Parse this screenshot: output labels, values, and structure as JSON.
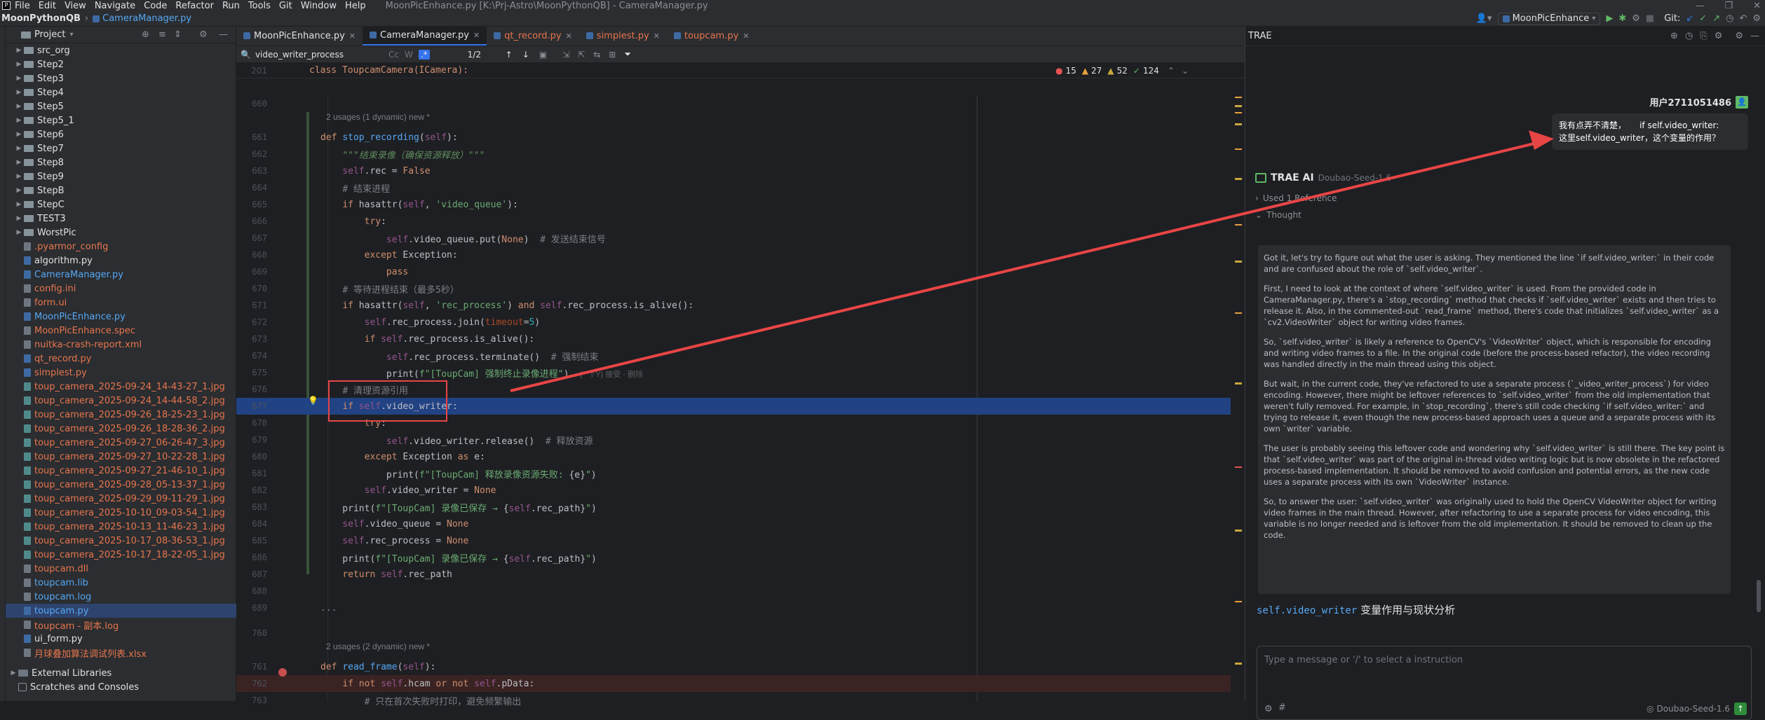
{
  "titlebar": {
    "menu": [
      "File",
      "Edit",
      "View",
      "Navigate",
      "Code",
      "Refactor",
      "Run",
      "Tools",
      "Git",
      "Window",
      "Help"
    ],
    "window_title": "MoonPicEnhance.py [K:\\Prj-Astro\\MoonPythonQB] - CameraManager.py"
  },
  "navbar": {
    "project": "MoonPythonQB",
    "file": "CameraManager.py",
    "run_config": "MoonPicEnhance",
    "git_label": "Git:"
  },
  "project_panel": {
    "title": "Project",
    "items": [
      {
        "label": "src_org",
        "type": "folder",
        "color": "#dfe1e5"
      },
      {
        "label": "Step2",
        "type": "folder",
        "color": "#dfe1e5"
      },
      {
        "label": "Step3",
        "type": "folder",
        "color": "#dfe1e5"
      },
      {
        "label": "Step4",
        "type": "folder",
        "color": "#dfe1e5"
      },
      {
        "label": "Step5",
        "type": "folder",
        "color": "#dfe1e5"
      },
      {
        "label": "Step5_1",
        "type": "folder",
        "color": "#dfe1e5"
      },
      {
        "label": "Step6",
        "type": "folder",
        "color": "#dfe1e5"
      },
      {
        "label": "Step7",
        "type": "folder",
        "color": "#dfe1e5"
      },
      {
        "label": "Step8",
        "type": "folder",
        "color": "#dfe1e5"
      },
      {
        "label": "Step9",
        "type": "folder",
        "color": "#dfe1e5"
      },
      {
        "label": "StepB",
        "type": "folder",
        "color": "#dfe1e5"
      },
      {
        "label": "StepC",
        "type": "folder",
        "color": "#dfe1e5"
      },
      {
        "label": "TEST3",
        "type": "folder",
        "color": "#dfe1e5"
      },
      {
        "label": "WorstPic",
        "type": "folder",
        "color": "#dfe1e5"
      },
      {
        "label": ".pyarmor_config",
        "type": "file",
        "color": "#e8754d"
      },
      {
        "label": "algorithm.py",
        "type": "file",
        "color": "#dfe1e5"
      },
      {
        "label": "CameraManager.py",
        "type": "file",
        "color": "#56a8f5"
      },
      {
        "label": "config.ini",
        "type": "file",
        "color": "#e8754d"
      },
      {
        "label": "form.ui",
        "type": "file",
        "color": "#e8754d"
      },
      {
        "label": "MoonPicEnhance.py",
        "type": "file",
        "color": "#56a8f5"
      },
      {
        "label": "MoonPicEnhance.spec",
        "type": "file",
        "color": "#e8754d"
      },
      {
        "label": "nuitka-crash-report.xml",
        "type": "file",
        "color": "#e8754d"
      },
      {
        "label": "qt_record.py",
        "type": "file",
        "color": "#e8754d"
      },
      {
        "label": "simplest.py",
        "type": "file",
        "color": "#e8754d"
      },
      {
        "label": "toup_camera_2025-09-24_14-43-27_1.jpg",
        "type": "file",
        "color": "#e8754d"
      },
      {
        "label": "toup_camera_2025-09-24_14-44-58_2.jpg",
        "type": "file",
        "color": "#e8754d"
      },
      {
        "label": "toup_camera_2025-09-26_18-25-23_1.jpg",
        "type": "file",
        "color": "#e8754d"
      },
      {
        "label": "toup_camera_2025-09-26_18-28-36_2.jpg",
        "type": "file",
        "color": "#e8754d"
      },
      {
        "label": "toup_camera_2025-09-27_06-26-47_3.jpg",
        "type": "file",
        "color": "#e8754d"
      },
      {
        "label": "toup_camera_2025-09-27_10-22-28_1.jpg",
        "type": "file",
        "color": "#e8754d"
      },
      {
        "label": "toup_camera_2025-09-27_21-46-10_1.jpg",
        "type": "file",
        "color": "#e8754d"
      },
      {
        "label": "toup_camera_2025-09-28_05-13-37_1.jpg",
        "type": "file",
        "color": "#e8754d"
      },
      {
        "label": "toup_camera_2025-09-29_09-11-29_1.jpg",
        "type": "file",
        "color": "#e8754d"
      },
      {
        "label": "toup_camera_2025-10-10_09-03-54_1.jpg",
        "type": "file",
        "color": "#e8754d"
      },
      {
        "label": "toup_camera_2025-10-13_11-46-23_1.jpg",
        "type": "file",
        "color": "#e8754d"
      },
      {
        "label": "toup_camera_2025-10-17_08-36-53_1.jpg",
        "type": "file",
        "color": "#e8754d"
      },
      {
        "label": "toup_camera_2025-10-17_18-22-05_1.jpg",
        "type": "file",
        "color": "#e8754d"
      },
      {
        "label": "toupcam.dll",
        "type": "file",
        "color": "#e8754d"
      },
      {
        "label": "toupcam.lib",
        "type": "file",
        "color": "#56a8f5"
      },
      {
        "label": "toupcam.log",
        "type": "file",
        "color": "#56a8f5"
      },
      {
        "label": "toupcam.py",
        "type": "file",
        "color": "#56a8f5"
      },
      {
        "label": "toupcam - 副本.log",
        "type": "file",
        "color": "#e8754d"
      },
      {
        "label": "ui_form.py",
        "type": "file",
        "color": "#dfe1e5"
      },
      {
        "label": "月球叠加算法调试列表.xlsx",
        "type": "file",
        "color": "#e8754d"
      }
    ],
    "external_libraries": "External Libraries",
    "scratches": "Scratches and Consoles"
  },
  "editor": {
    "tabs": [
      {
        "label": "MoonPicEnhance.py",
        "active": false
      },
      {
        "label": "CameraManager.py",
        "active": true
      },
      {
        "label": "qt_record.py",
        "active": false
      },
      {
        "label": "simplest.py",
        "active": false
      },
      {
        "label": "toupcam.py",
        "active": false
      }
    ],
    "find": {
      "value": "video_writer_process",
      "count": "1/2"
    },
    "breadcrumb": {
      "line": "201",
      "text": "class ToupcamCamera(ICamera):"
    },
    "inspections": {
      "errors": "15",
      "warnings": "27",
      "weak": "52",
      "ok": "124"
    },
    "usages_1": "2 usages (1 dynamic)   new *",
    "usages_2": "2 usages (2 dynamic)   new *",
    "collapsed": "...",
    "inline_hint": "(⌃⇧Y) 接受 · 删除",
    "lines": [
      {
        "n": "660",
        "html": ""
      },
      {
        "n": "661",
        "html": "<span class='kw'>def</span> <span class='fn'>stop_recording</span>(<span class='sf'>self</span>):"
      },
      {
        "n": "662",
        "html": "    <span class='it'>\"\"\"结束录像（确保资源释放）\"\"\"</span>"
      },
      {
        "n": "663",
        "html": "    <span class='sf'>self</span>.rec = <span class='kw'>False</span>"
      },
      {
        "n": "664",
        "html": "    <span class='cm'># 结束进程</span>"
      },
      {
        "n": "665",
        "html": "    <span class='kw'>if</span> hasattr(<span class='sf'>self</span>, <span class='st'>'video_queue'</span>):"
      },
      {
        "n": "666",
        "html": "        <span class='kw'>try</span>:"
      },
      {
        "n": "667",
        "html": "            <span class='sf'>self</span>.video_queue.put(<span class='kw'>None</span>)  <span class='cm'># 发送结束信号</span>"
      },
      {
        "n": "668",
        "html": "        <span class='kw'>except</span> Exception:"
      },
      {
        "n": "669",
        "html": "            <span class='kw'>pass</span>"
      },
      {
        "n": "670",
        "html": "    <span class='cm'># 等待进程结束（最多5秒）</span>"
      },
      {
        "n": "671",
        "html": "    <span class='kw'>if</span> hasattr(<span class='sf'>self</span>, <span class='st'>'rec_process'</span>) <span class='kw'>and</span> <span class='sf'>self</span>.rec_process.is_alive():"
      },
      {
        "n": "672",
        "html": "        <span class='sf'>self</span>.rec_process.join(<span class='pa'>timeout</span>=<span class='nm'>5</span>)"
      },
      {
        "n": "673",
        "html": "        <span class='kw'>if</span> <span class='sf'>self</span>.rec_process.is_alive():"
      },
      {
        "n": "674",
        "html": "            <span class='sf'>self</span>.rec_process.terminate()  <span class='cm'># 强制结束</span>"
      },
      {
        "n": "675",
        "html": "            print(<span class='st'>f\"[ToupCam] 强制终止录像进程\"</span>)"
      },
      {
        "n": "676",
        "html": "    <span class='cm'># 清理资源引用</span>"
      },
      {
        "n": "677",
        "html": "    <span class='kw'>if</span> <span class='sf'>self</span>.video_writer:"
      },
      {
        "n": "678",
        "html": "        <span class='kw'>try</span>:"
      },
      {
        "n": "679",
        "html": "            <span class='sf'>self</span>.video_writer.release()  <span class='cm'># 释放资源</span>"
      },
      {
        "n": "680",
        "html": "        <span class='kw'>except</span> Exception <span class='kw'>as</span> e:"
      },
      {
        "n": "681",
        "html": "            print(<span class='st'>f\"[ToupCam] 释放录像资源失败: </span>{e}<span class='st'>\"</span>)"
      },
      {
        "n": "682",
        "html": "        <span class='sf'>self</span>.video_writer = <span class='kw'>None</span>"
      },
      {
        "n": "683",
        "html": "    print(<span class='st'>f\"[ToupCam] 录像已保存 → </span>{<span class='sf'>self</span>.rec_path}<span class='st'>\"</span>)"
      },
      {
        "n": "684",
        "html": "    <span class='sf'>self</span>.video_queue = <span class='kw'>None</span>"
      },
      {
        "n": "685",
        "html": "    <span class='sf'>self</span>.rec_process = <span class='kw'>None</span>"
      },
      {
        "n": "686",
        "html": "    print(<span class='st'>f\"[ToupCam] 录像已保存 → </span>{<span class='sf'>self</span>.rec_path}<span class='st'>\"</span>)"
      },
      {
        "n": "687",
        "html": "    <span class='kw'>return</span> <span class='sf'>self</span>.rec_path"
      },
      {
        "n": "688",
        "html": ""
      },
      {
        "n": "689",
        "html": "<span class='cm'>...</span>"
      },
      {
        "n": "760",
        "html": ""
      },
      {
        "n": "761",
        "html": "<span class='kw'>def</span> <span class='fn'>read_frame</span>(<span class='sf'>self</span>):"
      },
      {
        "n": "762",
        "html": "    <span class='kw'>if</span> <span class='kw'>not</span> <span class='sf'>self</span>.hcam <span class='kw'>or</span> <span class='kw'>not</span> <span class='sf'>self</span>.pData:"
      },
      {
        "n": "763",
        "html": "        <span class='cm'># 只在首次失败时打印，避免频繁输出</span>"
      }
    ]
  },
  "ai_panel": {
    "title": "TRAE",
    "user_name": "用户2711051486",
    "user_message": "我有点弄不清楚，     if self.video_writer:\n这里self.video_writer，这个变量的作用？",
    "assistant_name": "TRAE AI",
    "model": "Doubao-Seed-1.6",
    "used_reference": "Used 1 Reference",
    "thought_label": "Thought",
    "thought_paragraphs": [
      "Got it, let's try to figure out what the user is asking. They mentioned the line `if self.video_writer:` in their code and are confused about the role of `self.video_writer`.",
      "First, I need to look at the context of where `self.video_writer` is used. From the provided code in CameraManager.py, there's a `stop_recording` method that checks if `self.video_writer` exists and then tries to release it. Also, in the commented-out `read_frame` method, there's code that initializes `self.video_writer` as a `cv2.VideoWriter` object for writing video frames.",
      "So, `self.video_writer` is likely a reference to OpenCV's `VideoWriter` object, which is responsible for encoding and writing video frames to a file. In the original code (before the process-based refactor), the video recording was handled directly in the main thread using this object.",
      "But wait, in the current code, they've refactored to use a separate process (`_video_writer_process`) for video encoding. However, there might be leftover references to `self.video_writer` from the old implementation that weren't fully removed. For example, in `stop_recording`, there's still code checking `if self.video_writer:` and trying to release it, even though the new process-based approach uses a queue and a separate process with its own `writer` variable.",
      "The user is probably seeing this leftover code and wondering why `self.video_writer` is still there. The key point is that `self.video_writer` was part of the original in-thread video writing logic but is now obsolete in the refactored process-based implementation. It should be removed to avoid confusion and potential errors, as the new code uses a separate process with its own `VideoWriter` instance.",
      "So, to answer the user: `self.video_writer` was originally used to hold the OpenCV VideoWriter object for writing video frames in the main thread. However, after refactoring to use a separate process for video encoding, this variable is no longer needed and is leftover from the old implementation. It should be removed to clean up the code."
    ],
    "answer_heading_code": "self.video_writer",
    "answer_heading_text": " 变量作用与现状分析",
    "input_placeholder": "Type a message or '/' to select a instruction",
    "model_selector": "Doubao-Seed-1.6"
  }
}
